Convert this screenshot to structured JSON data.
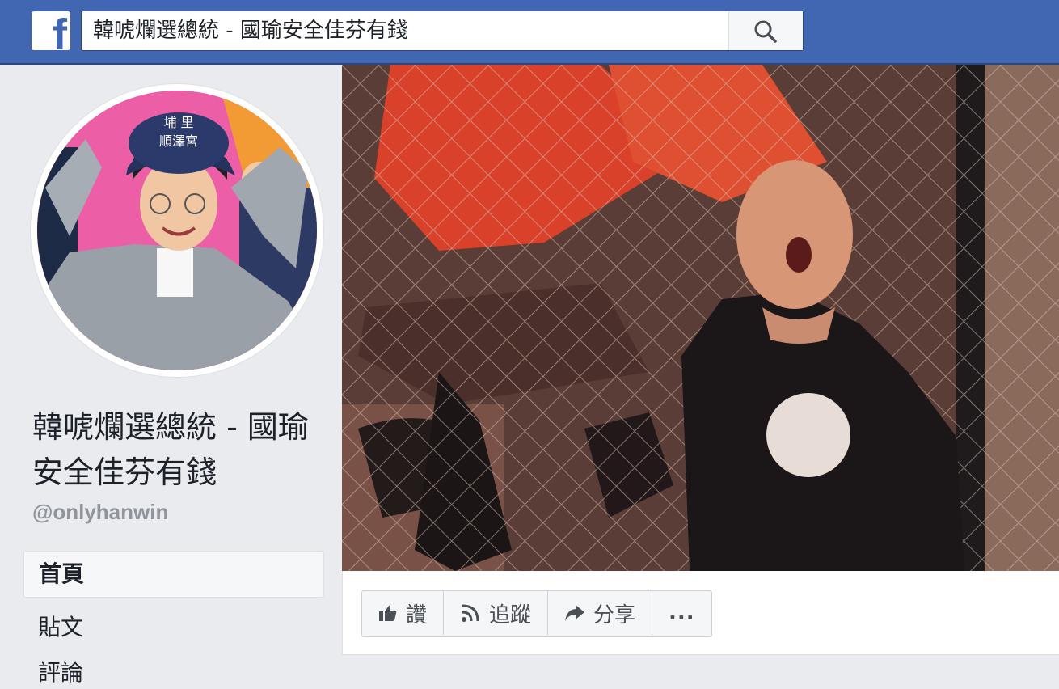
{
  "header": {
    "logo_icon": "facebook-f-logo",
    "search_value": "韓唬爛選總統 - 國瑜安全佳芬有錢",
    "search_icon": "search-icon",
    "brand_color": "#4267b2"
  },
  "profile": {
    "name": "韓唬爛選總統 - 國瑜安全佳芬有錢",
    "handle": "@onlyhanwin",
    "hat_text": "埔里\n順澤宮"
  },
  "nav": {
    "home": "首頁",
    "posts": "貼文",
    "more": "評論"
  },
  "actions": {
    "like": "讚",
    "follow": "追蹤",
    "share": "分享",
    "more": "..."
  }
}
